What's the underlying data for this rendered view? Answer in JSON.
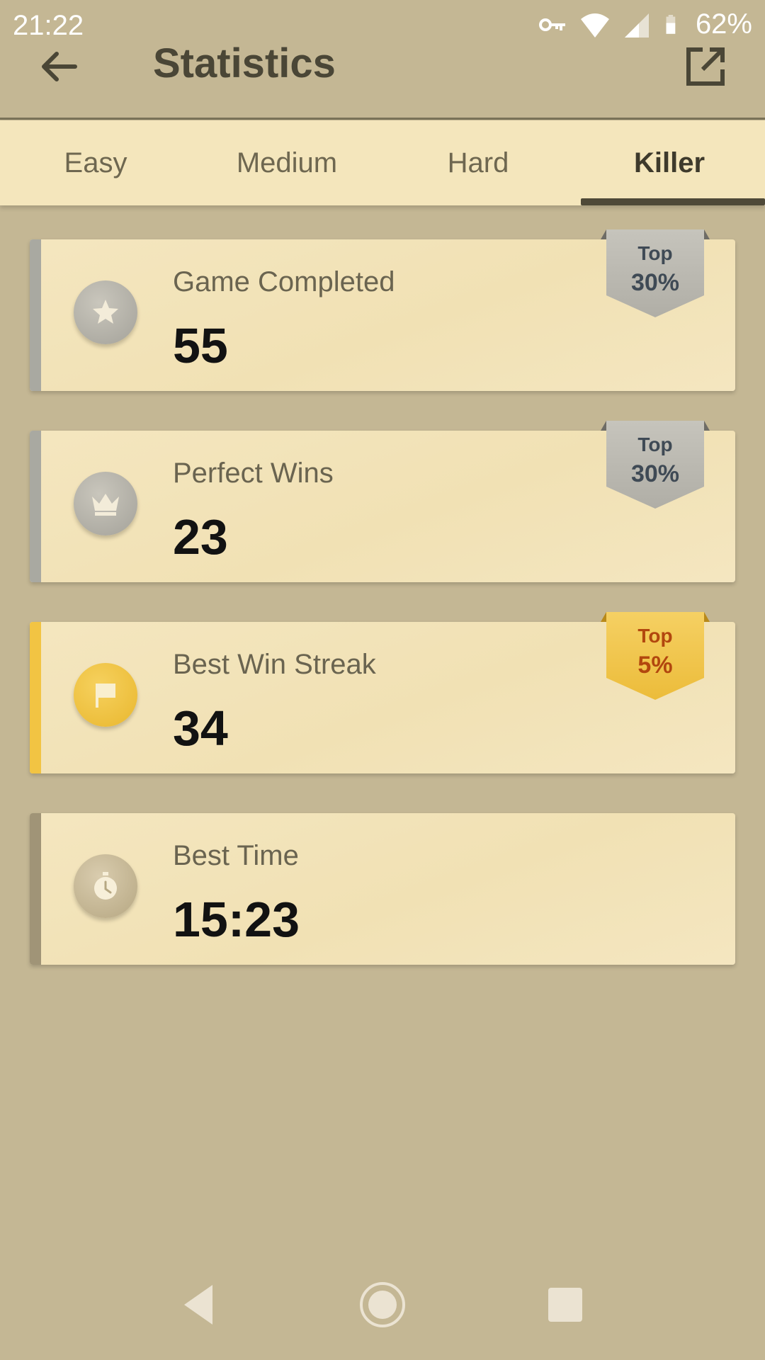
{
  "status_bar": {
    "time": "21:22",
    "battery": "62%",
    "icons": [
      "vpn-key-icon",
      "wifi-icon",
      "signal-icon",
      "battery-icon"
    ]
  },
  "app_bar": {
    "title": "Statistics",
    "back_icon": "arrow-left-icon",
    "share_icon": "share-external-icon"
  },
  "tabs": [
    {
      "label": "Easy",
      "active": false
    },
    {
      "label": "Medium",
      "active": false
    },
    {
      "label": "Hard",
      "active": false
    },
    {
      "label": "Killer",
      "active": true
    }
  ],
  "stats": [
    {
      "label": "Game Completed",
      "value": "55",
      "icon": "star-icon",
      "accent": "#a9a9a1",
      "badge": {
        "top": "Top",
        "pct": "30%",
        "color": "#bdbbb3",
        "text_color": "#3f4a55"
      }
    },
    {
      "label": "Perfect Wins",
      "value": "23",
      "icon": "crown-icon",
      "accent": "#a9a9a1",
      "badge": {
        "top": "Top",
        "pct": "30%",
        "color": "#bdbbb3",
        "text_color": "#3f4a55"
      }
    },
    {
      "label": "Best Win Streak",
      "value": "34",
      "icon": "flag-icon",
      "accent": "#f2c443",
      "badge": {
        "top": "Top",
        "pct": "5%",
        "color": "#f0c64b",
        "text_color": "#b2470e"
      }
    },
    {
      "label": "Best Time",
      "value": "15:23",
      "icon": "stopwatch-icon",
      "accent": "#a09477",
      "badge": null
    }
  ],
  "colors": {
    "background": "#c4b794",
    "card": "#f2e3b8",
    "tab_bar": "#f4e6bc",
    "title_text": "#4a4636"
  },
  "nav_bar": {
    "back_icon": "nav-back-triangle-icon",
    "home_icon": "nav-home-circle-icon",
    "recent_icon": "nav-recents-square-icon"
  }
}
